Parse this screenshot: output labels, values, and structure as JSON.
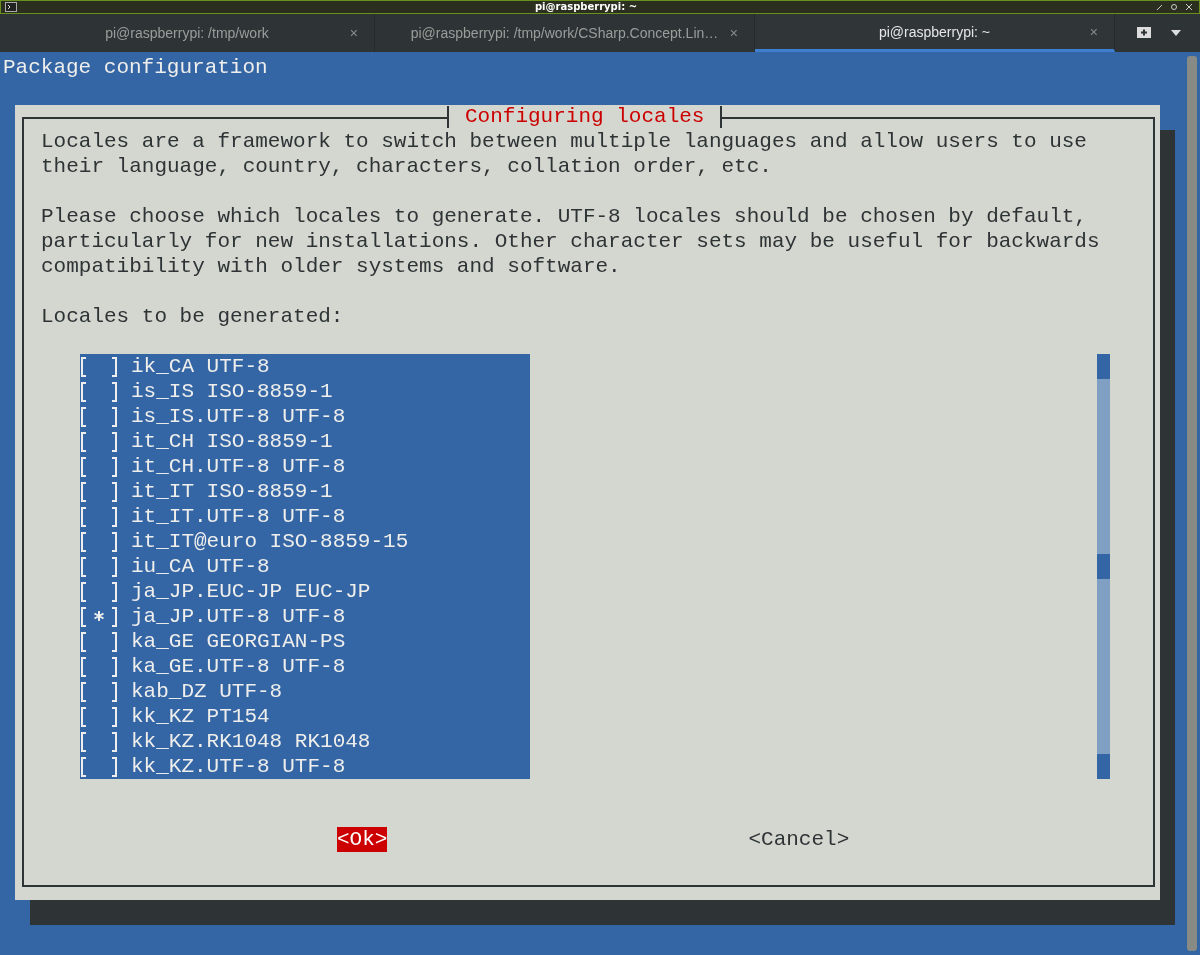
{
  "window": {
    "title": "pi@raspberrypi: ~"
  },
  "tabs": [
    {
      "label": "pi@raspberrypi: /tmp/work",
      "close": "×",
      "selected": false
    },
    {
      "label": "pi@raspberrypi: /tmp/work/CSharp.Concept.Lin…",
      "close": "×",
      "selected": false
    },
    {
      "label": "pi@raspberrypi: ~",
      "close": "×",
      "selected": true
    }
  ],
  "terminal": {
    "header": "Package configuration",
    "dialog": {
      "title": "Configuring locales",
      "paragraphs": [
        "Locales are a framework to switch between multiple languages and allow users to use\ntheir language, country, characters, collation order, etc.",
        "Please choose which locales to generate. UTF-8 locales should be chosen by default,\nparticularly for new installations. Other character sets may be useful for backwards\ncompatibility with older systems and software."
      ],
      "prompt": "Locales to be generated:",
      "locales": [
        {
          "label": "ik_CA UTF-8",
          "checked": false
        },
        {
          "label": "is_IS ISO-8859-1",
          "checked": false
        },
        {
          "label": "is_IS.UTF-8 UTF-8",
          "checked": false
        },
        {
          "label": "it_CH ISO-8859-1",
          "checked": false
        },
        {
          "label": "it_CH.UTF-8 UTF-8",
          "checked": false
        },
        {
          "label": "it_IT ISO-8859-1",
          "checked": false
        },
        {
          "label": "it_IT.UTF-8 UTF-8",
          "checked": false
        },
        {
          "label": "it_IT@euro ISO-8859-15",
          "checked": false
        },
        {
          "label": "iu_CA UTF-8",
          "checked": false
        },
        {
          "label": "ja_JP.EUC-JP EUC-JP",
          "checked": false
        },
        {
          "label": "ja_JP.UTF-8 UTF-8",
          "checked": true
        },
        {
          "label": "ka_GE GEORGIAN-PS",
          "checked": false
        },
        {
          "label": "ka_GE.UTF-8 UTF-8",
          "checked": false
        },
        {
          "label": "kab_DZ UTF-8",
          "checked": false
        },
        {
          "label": "kk_KZ PT154",
          "checked": false
        },
        {
          "label": "kk_KZ.RK1048 RK1048",
          "checked": false
        },
        {
          "label": "kk_KZ.UTF-8 UTF-8",
          "checked": false
        }
      ],
      "buttons": [
        {
          "label": "<Ok>",
          "selected": true
        },
        {
          "label": "<Cancel>",
          "selected": false
        }
      ]
    }
  }
}
